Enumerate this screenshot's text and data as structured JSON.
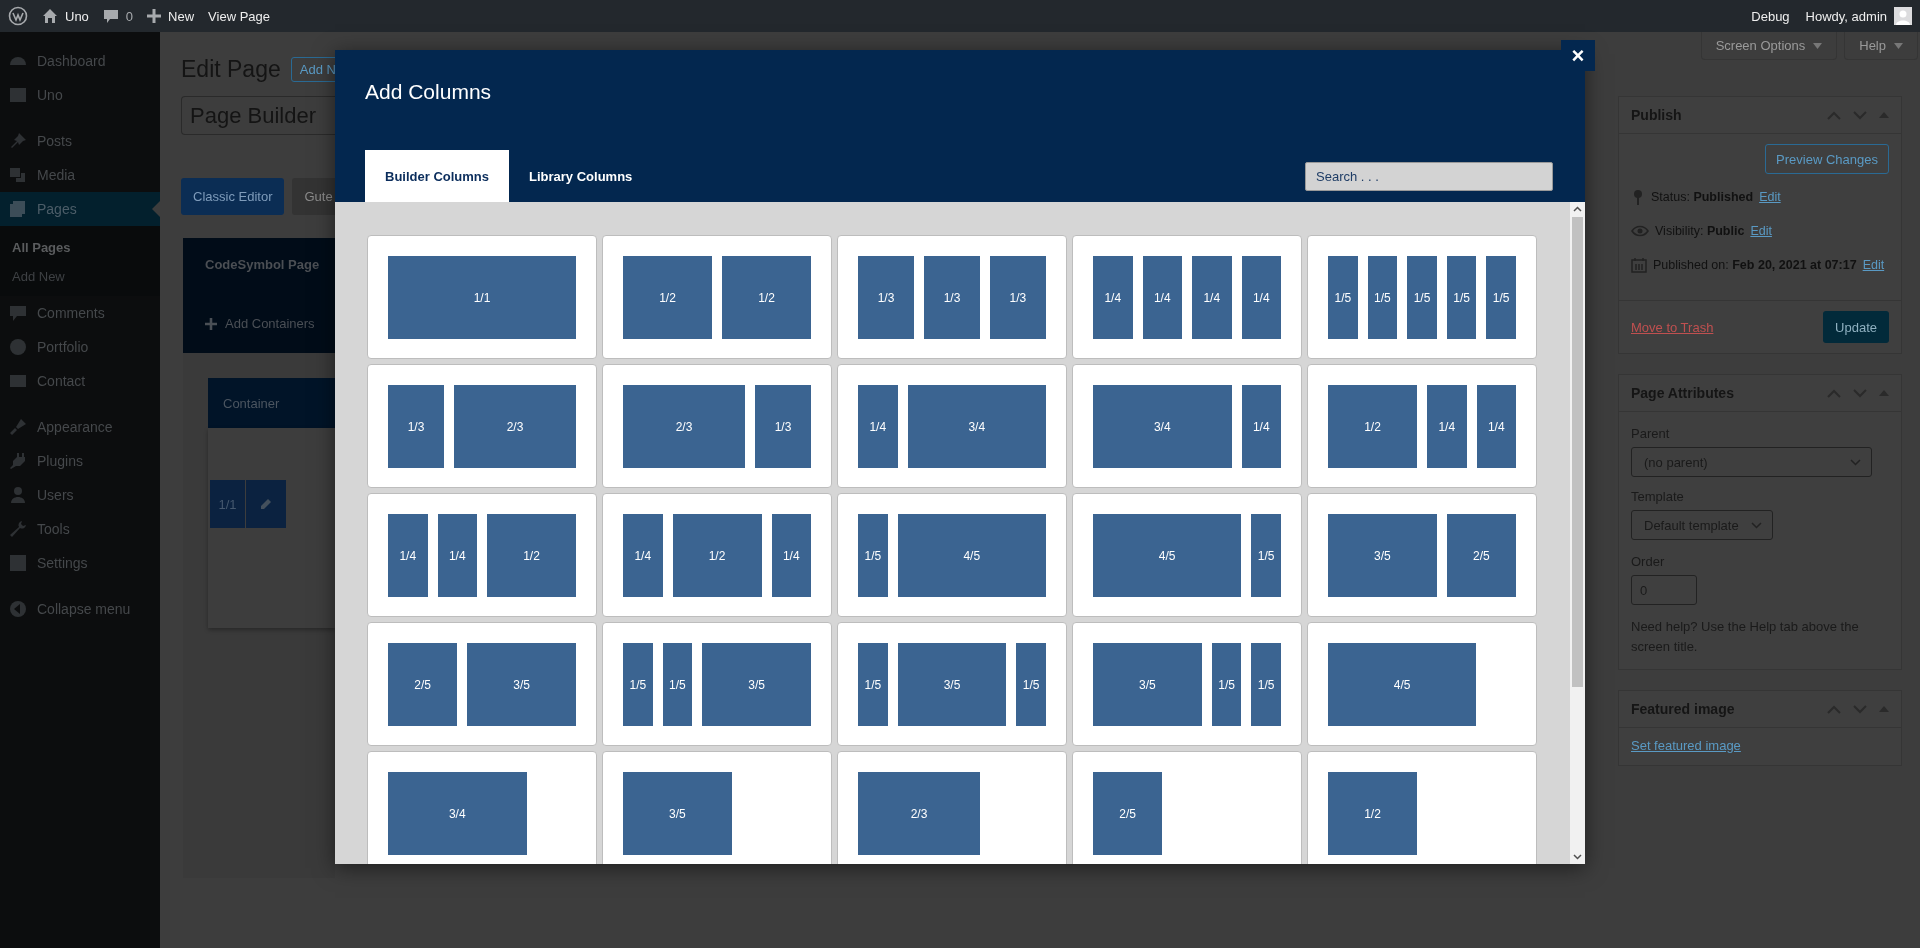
{
  "admin_bar": {
    "site": "Uno",
    "comments": "0",
    "new": "New",
    "view": "View Page",
    "debug": "Debug",
    "greeting": "Howdy, admin"
  },
  "sidebar": {
    "groups": [
      [
        {
          "label": "Dashboard",
          "selected": false
        },
        {
          "label": "Uno",
          "selected": false
        }
      ],
      [
        {
          "label": "Posts",
          "selected": false
        },
        {
          "label": "Media",
          "selected": false
        },
        {
          "label": "Pages",
          "selected": true,
          "children": [
            {
              "label": "All Pages",
              "selected": true
            },
            {
              "label": "Add New",
              "selected": false
            }
          ]
        },
        {
          "label": "Comments",
          "selected": false
        },
        {
          "label": "Portfolio",
          "selected": false
        },
        {
          "label": "Contact",
          "selected": false
        }
      ],
      [
        {
          "label": "Appearance",
          "selected": false
        },
        {
          "label": "Plugins",
          "selected": false
        },
        {
          "label": "Users",
          "selected": false
        },
        {
          "label": "Tools",
          "selected": false
        },
        {
          "label": "Settings",
          "selected": false
        }
      ]
    ],
    "collapse": "Collapse menu"
  },
  "editor": {
    "title": "Edit Page",
    "add_new": "Add N",
    "title_value": "Page Builder",
    "modes": [
      {
        "label": "Classic Editor",
        "selected": true
      },
      {
        "label": "Gute",
        "selected": false
      }
    ],
    "builder_title": "CodeSymbol Page",
    "add_containers": "Add Containers",
    "container_title": "Container",
    "column_size": "1/1"
  },
  "screen_options": "Screen Options",
  "help": "Help",
  "publish": {
    "title": "Publish",
    "preview": "Preview Changes",
    "rows": [
      {
        "text": "Status: **Published**",
        "link": "Edit"
      },
      {
        "text": "Visibility: **Public**",
        "link": "Edit"
      },
      {
        "text": "Published on: **Feb 20, 2021 at 07:17**",
        "link": "Edit"
      }
    ],
    "trash": "Move to Trash",
    "update": "Update"
  },
  "page_attributes": {
    "title": "Page Attributes",
    "parent_label": "Parent",
    "parent": "(no parent)",
    "template_label": "Template",
    "template": "Default template",
    "order_label": "Order",
    "order": "0",
    "help": "Need help? Use the Help tab above the screen title."
  },
  "featured_image": {
    "title": "Featured image",
    "link": "Set featured image"
  },
  "modal": {
    "title": "Add Columns",
    "close": "×",
    "tabs": [
      {
        "label": "Builder Columns",
        "selected": true
      },
      {
        "label": "Library Columns",
        "selected": false
      }
    ],
    "search": {
      "placeholder": "Search . . ."
    },
    "layouts": [
      {
        "columns": [
          "1/1"
        ]
      },
      {
        "columns": [
          "1/2",
          "1/2"
        ]
      },
      {
        "columns": [
          "1/3",
          "1/3",
          "1/3"
        ]
      },
      {
        "columns": [
          "1/4",
          "1/4",
          "1/4",
          "1/4"
        ]
      },
      {
        "columns": [
          "1/5",
          "1/5",
          "1/5",
          "1/5",
          "1/5"
        ]
      },
      {
        "columns": [
          "1/3",
          "2/3"
        ]
      },
      {
        "columns": [
          "2/3",
          "1/3"
        ]
      },
      {
        "columns": [
          "1/4",
          "3/4"
        ]
      },
      {
        "columns": [
          "3/4",
          "1/4"
        ]
      },
      {
        "columns": [
          "1/2",
          "1/4",
          "1/4"
        ]
      },
      {
        "columns": [
          "1/4",
          "1/4",
          "1/2"
        ]
      },
      {
        "columns": [
          "1/4",
          "1/2",
          "1/4"
        ]
      },
      {
        "columns": [
          "1/5",
          "4/5"
        ]
      },
      {
        "columns": [
          "4/5",
          "1/5"
        ]
      },
      {
        "columns": [
          "3/5",
          "2/5"
        ]
      },
      {
        "columns": [
          "2/5",
          "3/5"
        ]
      },
      {
        "columns": [
          "1/5",
          "1/5",
          "3/5"
        ]
      },
      {
        "columns": [
          "1/5",
          "3/5",
          "1/5"
        ]
      },
      {
        "columns": [
          "3/5",
          "1/5",
          "1/5"
        ]
      },
      {
        "columns": [
          "4/5"
        ]
      },
      {
        "columns": [
          "3/4"
        ]
      },
      {
        "columns": [
          "3/5"
        ]
      },
      {
        "columns": [
          "2/3"
        ]
      },
      {
        "columns": [
          "2/5"
        ]
      },
      {
        "columns": [
          "1/2"
        ]
      }
    ]
  }
}
